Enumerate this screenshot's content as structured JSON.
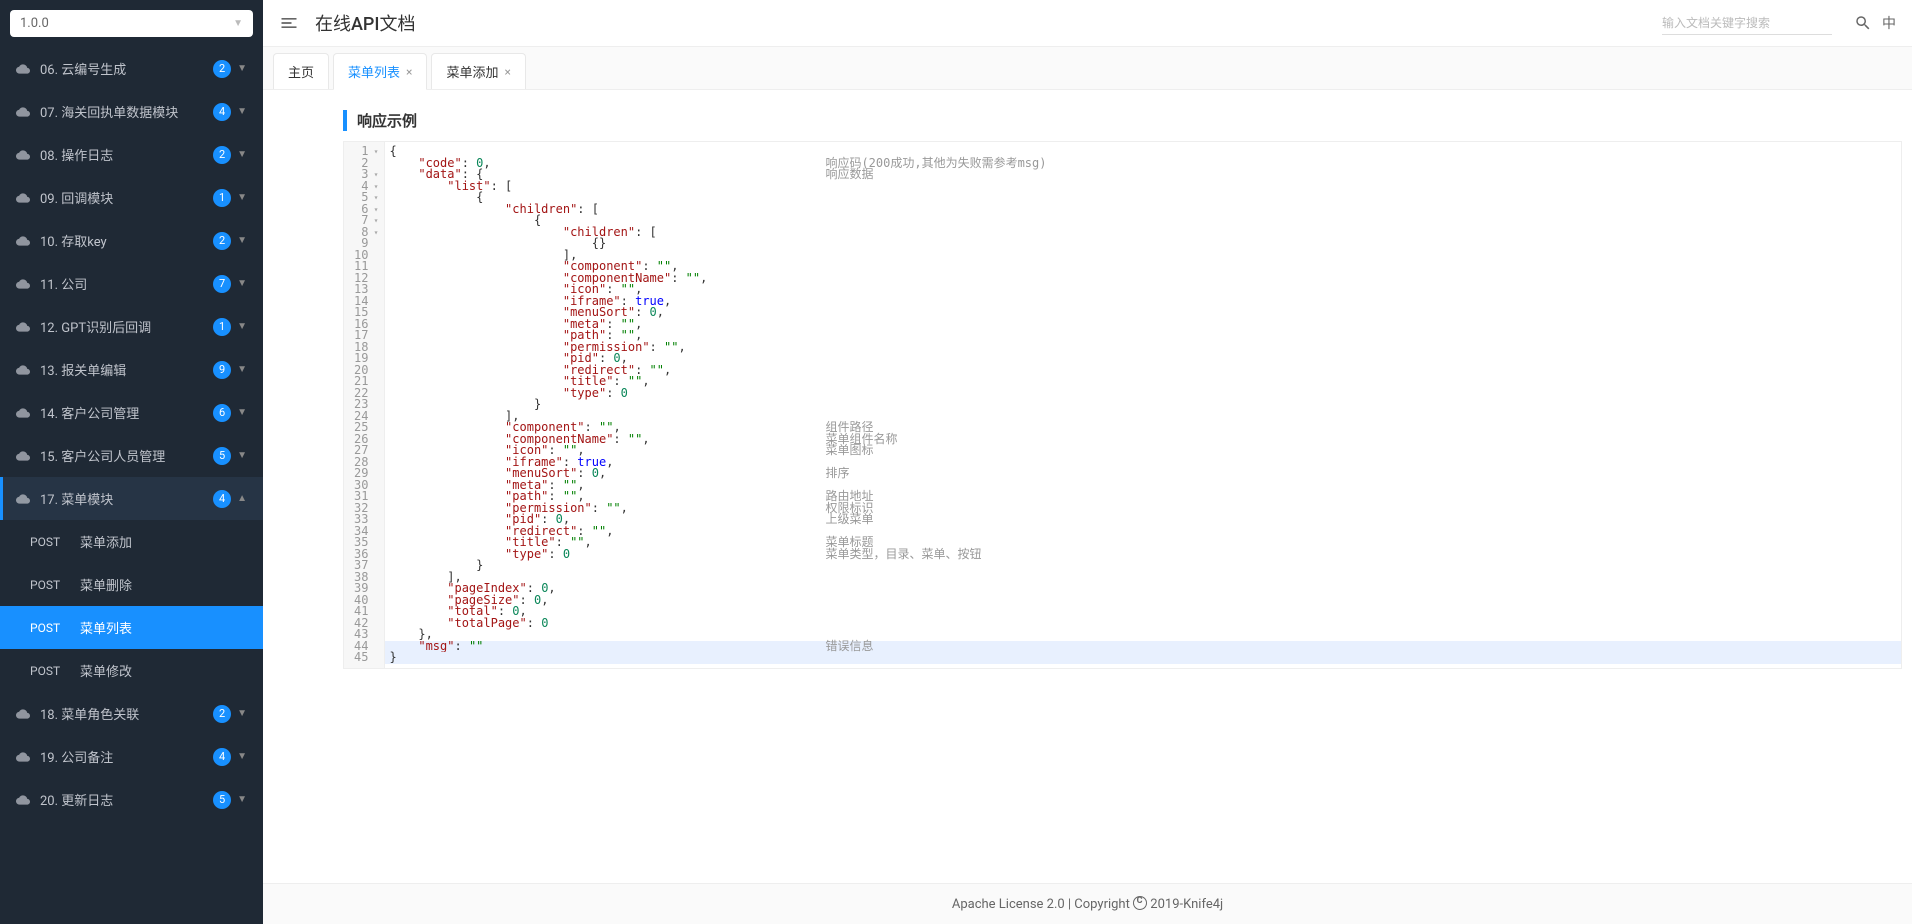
{
  "version": "1.0.0",
  "sidebar": {
    "items": [
      {
        "label": "06. 云编号生成",
        "badge": "2",
        "open": false
      },
      {
        "label": "07. 海关回执单数据模块",
        "badge": "4",
        "open": false
      },
      {
        "label": "08. 操作日志",
        "badge": "2",
        "open": false
      },
      {
        "label": "09. 回调模块",
        "badge": "1",
        "open": false
      },
      {
        "label": "10. 存取key",
        "badge": "2",
        "open": false
      },
      {
        "label": "11. 公司",
        "badge": "7",
        "open": false
      },
      {
        "label": "12. GPT识别后回调",
        "badge": "1",
        "open": false
      },
      {
        "label": "13. 报关单编辑",
        "badge": "9",
        "open": false
      },
      {
        "label": "14. 客户公司管理",
        "badge": "6",
        "open": false
      },
      {
        "label": "15. 客户公司人员管理",
        "badge": "5",
        "open": false
      },
      {
        "label": "17. 菜单模块",
        "badge": "4",
        "open": true
      },
      {
        "label": "18. 菜单角色关联",
        "badge": "2",
        "open": false
      },
      {
        "label": "19. 公司备注",
        "badge": "4",
        "open": false
      },
      {
        "label": "20. 更新日志",
        "badge": "5",
        "open": false
      }
    ],
    "submenu": [
      {
        "method": "POST",
        "label": "菜单添加",
        "active": false
      },
      {
        "method": "POST",
        "label": "菜单删除",
        "active": false
      },
      {
        "method": "POST",
        "label": "菜单列表",
        "active": true
      },
      {
        "method": "POST",
        "label": "菜单修改",
        "active": false
      }
    ]
  },
  "header": {
    "title": "在线API文档",
    "search_placeholder": "输入文档关键字搜索",
    "lang": "中"
  },
  "tabs": [
    {
      "label": "主页",
      "closable": false,
      "active": false
    },
    {
      "label": "菜单列表",
      "closable": true,
      "active": true
    },
    {
      "label": "菜单添加",
      "closable": true,
      "active": false
    }
  ],
  "section_title": "响应示例",
  "code": {
    "lines": [
      {
        "n": 1,
        "fold": true,
        "t": [
          {
            "p": "{"
          }
        ]
      },
      {
        "n": 2,
        "t": [
          {
            "s": "    "
          },
          {
            "k": "\"code\""
          },
          {
            "p": ": "
          },
          {
            "u": "0"
          },
          {
            "p": ","
          }
        ],
        "a": "响应码(200成功,其他为失败需参考msg)"
      },
      {
        "n": 3,
        "fold": true,
        "t": [
          {
            "s": "    "
          },
          {
            "k": "\"data\""
          },
          {
            "p": ": {"
          }
        ],
        "a": "响应数据"
      },
      {
        "n": 4,
        "fold": true,
        "t": [
          {
            "s": "        "
          },
          {
            "k": "\"list\""
          },
          {
            "p": ": ["
          }
        ]
      },
      {
        "n": 5,
        "fold": true,
        "t": [
          {
            "s": "            "
          },
          {
            "p": "{"
          }
        ]
      },
      {
        "n": 6,
        "fold": true,
        "t": [
          {
            "s": "                "
          },
          {
            "k": "\"children\""
          },
          {
            "p": ": ["
          }
        ]
      },
      {
        "n": 7,
        "fold": true,
        "t": [
          {
            "s": "                    "
          },
          {
            "p": "{"
          }
        ]
      },
      {
        "n": 8,
        "fold": true,
        "t": [
          {
            "s": "                        "
          },
          {
            "k": "\"children\""
          },
          {
            "p": ": ["
          }
        ]
      },
      {
        "n": 9,
        "t": [
          {
            "s": "                            "
          },
          {
            "p": "{}"
          }
        ]
      },
      {
        "n": 10,
        "t": [
          {
            "s": "                        "
          },
          {
            "p": "],"
          }
        ]
      },
      {
        "n": 11,
        "t": [
          {
            "s": "                        "
          },
          {
            "k": "\"component\""
          },
          {
            "p": ": "
          },
          {
            "v": "\"\""
          },
          {
            "p": ","
          }
        ]
      },
      {
        "n": 12,
        "t": [
          {
            "s": "                        "
          },
          {
            "k": "\"componentName\""
          },
          {
            "p": ": "
          },
          {
            "v": "\"\""
          },
          {
            "p": ","
          }
        ]
      },
      {
        "n": 13,
        "t": [
          {
            "s": "                        "
          },
          {
            "k": "\"icon\""
          },
          {
            "p": ": "
          },
          {
            "v": "\"\""
          },
          {
            "p": ","
          }
        ]
      },
      {
        "n": 14,
        "t": [
          {
            "s": "                        "
          },
          {
            "k": "\"iframe\""
          },
          {
            "p": ": "
          },
          {
            "b": "true"
          },
          {
            "p": ","
          }
        ]
      },
      {
        "n": 15,
        "t": [
          {
            "s": "                        "
          },
          {
            "k": "\"menuSort\""
          },
          {
            "p": ": "
          },
          {
            "u": "0"
          },
          {
            "p": ","
          }
        ]
      },
      {
        "n": 16,
        "t": [
          {
            "s": "                        "
          },
          {
            "k": "\"meta\""
          },
          {
            "p": ": "
          },
          {
            "v": "\"\""
          },
          {
            "p": ","
          }
        ]
      },
      {
        "n": 17,
        "t": [
          {
            "s": "                        "
          },
          {
            "k": "\"path\""
          },
          {
            "p": ": "
          },
          {
            "v": "\"\""
          },
          {
            "p": ","
          }
        ]
      },
      {
        "n": 18,
        "t": [
          {
            "s": "                        "
          },
          {
            "k": "\"permission\""
          },
          {
            "p": ": "
          },
          {
            "v": "\"\""
          },
          {
            "p": ","
          }
        ]
      },
      {
        "n": 19,
        "t": [
          {
            "s": "                        "
          },
          {
            "k": "\"pid\""
          },
          {
            "p": ": "
          },
          {
            "u": "0"
          },
          {
            "p": ","
          }
        ]
      },
      {
        "n": 20,
        "t": [
          {
            "s": "                        "
          },
          {
            "k": "\"redirect\""
          },
          {
            "p": ": "
          },
          {
            "v": "\"\""
          },
          {
            "p": ","
          }
        ]
      },
      {
        "n": 21,
        "t": [
          {
            "s": "                        "
          },
          {
            "k": "\"title\""
          },
          {
            "p": ": "
          },
          {
            "v": "\"\""
          },
          {
            "p": ","
          }
        ]
      },
      {
        "n": 22,
        "t": [
          {
            "s": "                        "
          },
          {
            "k": "\"type\""
          },
          {
            "p": ": "
          },
          {
            "u": "0"
          }
        ]
      },
      {
        "n": 23,
        "t": [
          {
            "s": "                    "
          },
          {
            "p": "}"
          }
        ]
      },
      {
        "n": 24,
        "t": [
          {
            "s": "                "
          },
          {
            "p": "],"
          }
        ]
      },
      {
        "n": 25,
        "t": [
          {
            "s": "                "
          },
          {
            "k": "\"component\""
          },
          {
            "p": ": "
          },
          {
            "v": "\"\""
          },
          {
            "p": ","
          }
        ],
        "a": "组件路径"
      },
      {
        "n": 26,
        "t": [
          {
            "s": "                "
          },
          {
            "k": "\"componentName\""
          },
          {
            "p": ": "
          },
          {
            "v": "\"\""
          },
          {
            "p": ","
          }
        ],
        "a": "菜单组件名称"
      },
      {
        "n": 27,
        "t": [
          {
            "s": "                "
          },
          {
            "k": "\"icon\""
          },
          {
            "p": ": "
          },
          {
            "v": "\"\""
          },
          {
            "p": ","
          }
        ],
        "a": "菜单图标"
      },
      {
        "n": 28,
        "t": [
          {
            "s": "                "
          },
          {
            "k": "\"iframe\""
          },
          {
            "p": ": "
          },
          {
            "b": "true"
          },
          {
            "p": ","
          }
        ]
      },
      {
        "n": 29,
        "t": [
          {
            "s": "                "
          },
          {
            "k": "\"menuSort\""
          },
          {
            "p": ": "
          },
          {
            "u": "0"
          },
          {
            "p": ","
          }
        ],
        "a": "排序"
      },
      {
        "n": 30,
        "t": [
          {
            "s": "                "
          },
          {
            "k": "\"meta\""
          },
          {
            "p": ": "
          },
          {
            "v": "\"\""
          },
          {
            "p": ","
          }
        ]
      },
      {
        "n": 31,
        "t": [
          {
            "s": "                "
          },
          {
            "k": "\"path\""
          },
          {
            "p": ": "
          },
          {
            "v": "\"\""
          },
          {
            "p": ","
          }
        ],
        "a": "路由地址"
      },
      {
        "n": 32,
        "t": [
          {
            "s": "                "
          },
          {
            "k": "\"permission\""
          },
          {
            "p": ": "
          },
          {
            "v": "\"\""
          },
          {
            "p": ","
          }
        ],
        "a": "权限标识"
      },
      {
        "n": 33,
        "t": [
          {
            "s": "                "
          },
          {
            "k": "\"pid\""
          },
          {
            "p": ": "
          },
          {
            "u": "0"
          },
          {
            "p": ","
          }
        ],
        "a": "上级菜单"
      },
      {
        "n": 34,
        "t": [
          {
            "s": "                "
          },
          {
            "k": "\"redirect\""
          },
          {
            "p": ": "
          },
          {
            "v": "\"\""
          },
          {
            "p": ","
          }
        ]
      },
      {
        "n": 35,
        "t": [
          {
            "s": "                "
          },
          {
            "k": "\"title\""
          },
          {
            "p": ": "
          },
          {
            "v": "\"\""
          },
          {
            "p": ","
          }
        ],
        "a": "菜单标题"
      },
      {
        "n": 36,
        "t": [
          {
            "s": "                "
          },
          {
            "k": "\"type\""
          },
          {
            "p": ": "
          },
          {
            "u": "0"
          }
        ],
        "a": "菜单类型，目录、菜单、按钮"
      },
      {
        "n": 37,
        "t": [
          {
            "s": "            "
          },
          {
            "p": "}"
          }
        ]
      },
      {
        "n": 38,
        "t": [
          {
            "s": "        "
          },
          {
            "p": "],"
          }
        ]
      },
      {
        "n": 39,
        "t": [
          {
            "s": "        "
          },
          {
            "k": "\"pageIndex\""
          },
          {
            "p": ": "
          },
          {
            "u": "0"
          },
          {
            "p": ","
          }
        ]
      },
      {
        "n": 40,
        "t": [
          {
            "s": "        "
          },
          {
            "k": "\"pageSize\""
          },
          {
            "p": ": "
          },
          {
            "u": "0"
          },
          {
            "p": ","
          }
        ]
      },
      {
        "n": 41,
        "t": [
          {
            "s": "        "
          },
          {
            "k": "\"total\""
          },
          {
            "p": ": "
          },
          {
            "u": "0"
          },
          {
            "p": ","
          }
        ]
      },
      {
        "n": 42,
        "t": [
          {
            "s": "        "
          },
          {
            "k": "\"totalPage\""
          },
          {
            "p": ": "
          },
          {
            "u": "0"
          }
        ]
      },
      {
        "n": 43,
        "t": [
          {
            "s": "    "
          },
          {
            "p": "},"
          }
        ]
      },
      {
        "n": 44,
        "t": [
          {
            "s": "    "
          },
          {
            "k": "\"msg\""
          },
          {
            "p": ": "
          },
          {
            "v": "\"\""
          }
        ],
        "a": "错误信息",
        "hl": true
      },
      {
        "n": 45,
        "t": [
          {
            "p": "}"
          }
        ],
        "hl": true
      }
    ]
  },
  "footer": {
    "license": "Apache License 2.0",
    "sep": " | Copyright ",
    "owner": " 2019-Knife4j"
  }
}
